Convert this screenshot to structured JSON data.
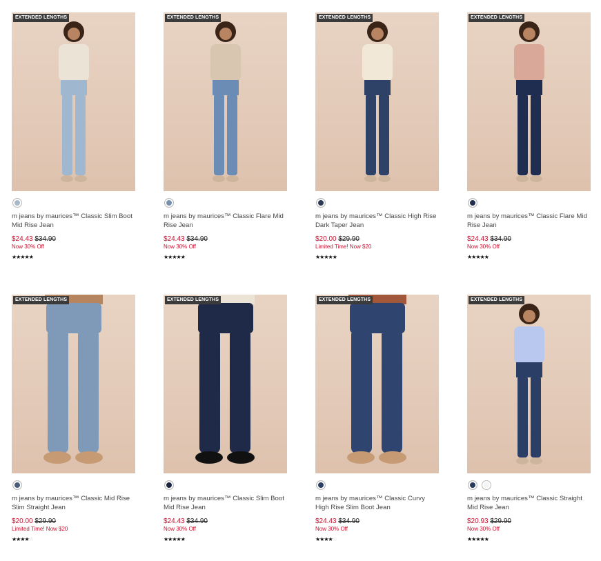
{
  "products": [
    {
      "badge": "EXTENDED LENGTHS",
      "name": "m jeans by maurices™ Classic Slim Boot Mid Rise Jean",
      "price_sale": "$24.43",
      "price_orig": "$34.90",
      "promo": "Now 30% Off",
      "rating": 4.5,
      "swatch_colors": [
        "#a8b8c8"
      ],
      "jean_color": "#9fb7cf",
      "top_color": "#ece3d7"
    },
    {
      "badge": "EXTENDED LENGTHS",
      "name": "m jeans by maurices™ Classic Flare Mid Rise Jean",
      "price_sale": "$24.43",
      "price_orig": "$34.90",
      "promo": "Now 30% Off",
      "rating": 4.5,
      "swatch_colors": [
        "#7890b0"
      ],
      "jean_color": "#6b8cb4",
      "top_color": "#d8c6b0"
    },
    {
      "badge": "EXTENDED LENGTHS",
      "name": "m jeans by maurices™ Classic High Rise Dark Taper Jean",
      "price_sale": "$20.00",
      "price_orig": "$29.90",
      "promo": "Limited Time! Now $20",
      "rating": 4.5,
      "swatch_colors": [
        "#2c3a55"
      ],
      "jean_color": "#2e4268",
      "top_color": "#f2e8d8"
    },
    {
      "badge": "EXTENDED LENGTHS",
      "name": "m jeans by maurices™ Classic Flare Mid Rise Jean",
      "price_sale": "$24.43",
      "price_orig": "$34.90",
      "promo": "Now 30% Off",
      "rating": 4.5,
      "swatch_colors": [
        "#1f2d4d"
      ],
      "jean_color": "#1f2e50",
      "top_color": "#d9a898"
    },
    {
      "badge": "EXTENDED LENGTHS",
      "name": "m jeans by maurices™ Classic Mid Rise Slim Straight Jean",
      "price_sale": "$20.00",
      "price_orig": "$29.90",
      "promo": "Limited Time! Now $20",
      "rating": 4,
      "swatch_colors": [
        "#4a5c7a"
      ],
      "jean_color": "#7e9ab8",
      "top_color": "#b58560"
    },
    {
      "badge": "EXTENDED LENGTHS",
      "name": "m jeans by maurices™ Classic Slim Boot Mid Rise Jean",
      "price_sale": "$24.43",
      "price_orig": "$34.90",
      "promo": "Now 30% Off",
      "rating": 4.5,
      "swatch_colors": [
        "#1c2540"
      ],
      "jean_color": "#1e2a48",
      "top_color": "#ece3d7"
    },
    {
      "badge": "EXTENDED LENGTHS",
      "name": "m jeans by maurices™ Classic Curvy High Rise Slim Boot Jean",
      "price_sale": "$24.43",
      "price_orig": "$34.90",
      "promo": "Now 30% Off",
      "rating": 4,
      "swatch_colors": [
        "#2d3f62"
      ],
      "jean_color": "#2f4570",
      "top_color": "#a0573a"
    },
    {
      "badge": "EXTENDED LENGTHS",
      "name": "m jeans by maurices™ Classic Straight Mid Rise Jean",
      "price_sale": "$20.93",
      "price_orig": "$29.90",
      "promo": "Now 30% Off",
      "rating": 4.5,
      "swatch_colors": [
        "#2a3a5c",
        "#f4f4f4"
      ],
      "jean_color": "#2a3e66",
      "top_color": "#b9c8ee"
    }
  ]
}
